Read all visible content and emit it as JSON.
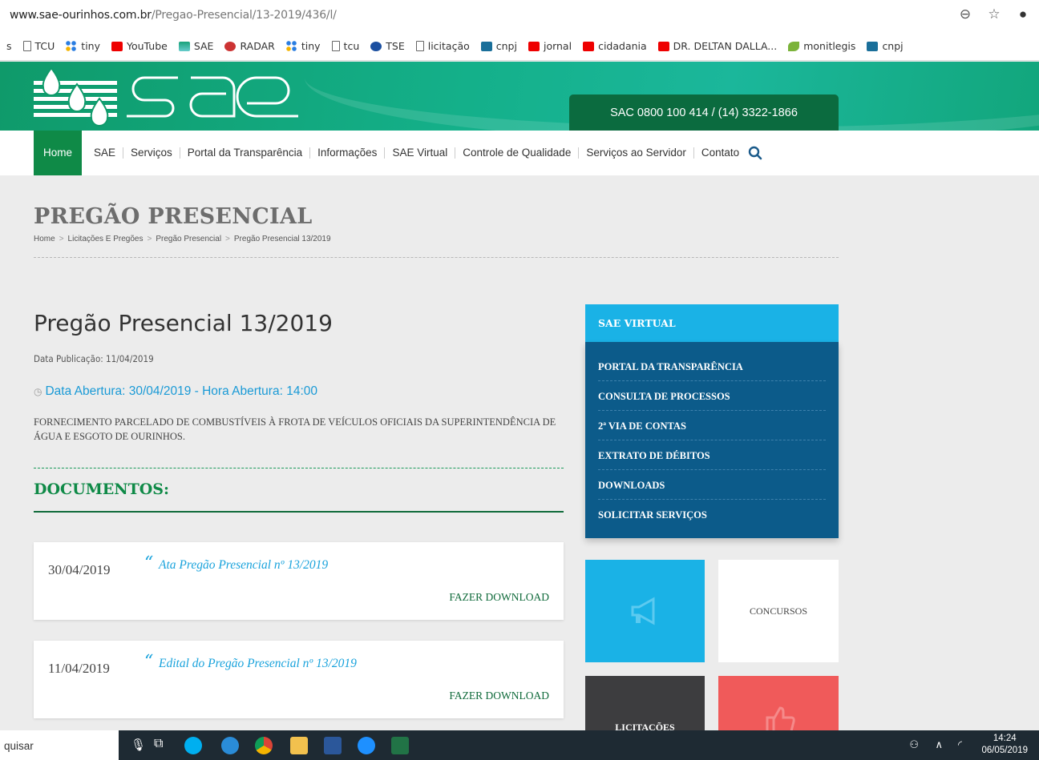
{
  "browser": {
    "url_host": "www.sae-ourinhos.com.br",
    "url_path": "/Pregao-Presencial/13-2019/436/l/",
    "bookmarks": [
      "s",
      "TCU",
      "tiny",
      "YouTube",
      "SAE",
      "RADAR",
      "tiny",
      "tcu",
      "TSE",
      "licitação",
      "cnpj",
      "jornal",
      "cidadania",
      "DR. DELTAN DALLA...",
      "monitlegis",
      "cnpj"
    ]
  },
  "header": {
    "sac": "SAC 0800 100 414 / (14) 3322-1866"
  },
  "nav": {
    "items": [
      "Home",
      "SAE",
      "Serviços",
      "Portal da Transparência",
      "Informações",
      "SAE Virtual",
      "Controle de Qualidade",
      "Serviços ao Servidor",
      "Contato"
    ]
  },
  "page": {
    "title": "PREGÃO PRESENCIAL",
    "breadcrumb": [
      "Home",
      "Licitações E Pregões",
      "Pregão Presencial",
      "Pregão Presencial 13/2019"
    ],
    "heading": "Pregão Presencial 13/2019",
    "pub_date": "Data Publicação: 11/04/2019",
    "opening": "Data Abertura: 30/04/2019 - Hora Abertura: 14:00",
    "description": "FORNECIMENTO PARCELADO DE COMBUSTÍVEIS À FROTA DE VEÍCULOS OFICIAIS DA SUPERINTENDÊNCIA DE ÁGUA E ESGOTO DE OURINHOS.",
    "docs_title": "DOCUMENTOS:",
    "documents": [
      {
        "date": "30/04/2019",
        "title": "Ata Pregão Presencial nº 13/2019",
        "action": "FAZER DOWNLOAD"
      },
      {
        "date": "11/04/2019",
        "title": "Edital do Pregão Presencial nº 13/2019",
        "action": "FAZER DOWNLOAD"
      }
    ]
  },
  "sidebar": {
    "title": "SAE VIRTUAL",
    "items": [
      "PORTAL DA TRANSPARÊNCIA",
      "CONSULTA DE PROCESSOS",
      "2ª VIA DE CONTAS",
      "EXTRATO DE DÉBITOS",
      "DOWNLOADS",
      "SOLICITAR SERVIÇOS"
    ],
    "tiles": [
      "CONCURSOS",
      "LICITAÇÕES"
    ]
  },
  "taskbar": {
    "search_text": "quisar",
    "time": "14:24",
    "date": "06/05/2019"
  },
  "colors": {
    "brand_green": "#0f8a47",
    "sidebar_blue": "#0c5b8a",
    "sidebar_head": "#1ab2e6",
    "link_blue": "#1aa3dc",
    "tile_red": "#f05a5a",
    "tile_dark": "#3d3d3f"
  }
}
